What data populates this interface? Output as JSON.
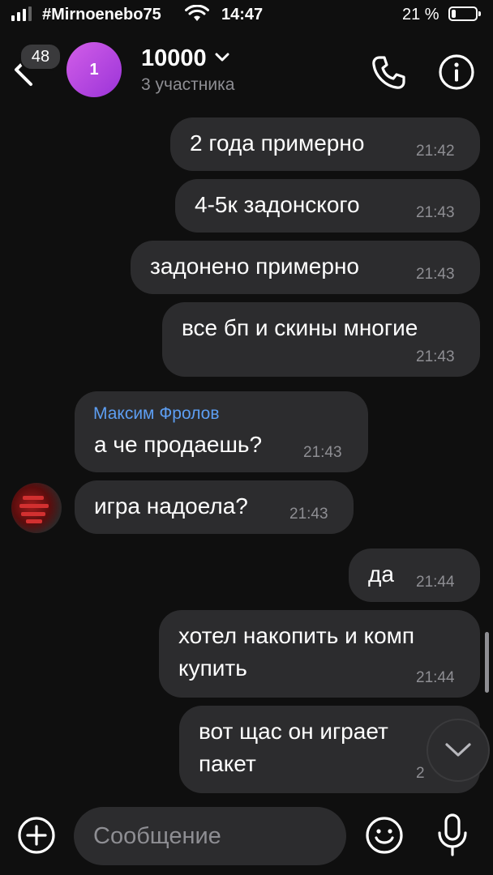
{
  "status_bar": {
    "carrier": "#Mirnoenebo75",
    "time": "14:47",
    "battery_percent": "21 %",
    "battery_level": 0.21,
    "signal_bars": 3
  },
  "header": {
    "unread_count": "48",
    "avatar_letter": "1",
    "title": "10000",
    "subtitle": "3 участника",
    "avatar_color": "#c34ee0"
  },
  "messages": [
    {
      "direction": "out",
      "text": "2 года примерно",
      "time": "21:42"
    },
    {
      "direction": "out",
      "text": "4-5к задонского",
      "time": "21:43"
    },
    {
      "direction": "out",
      "text": "задонено примерно",
      "time": "21:43"
    },
    {
      "direction": "out",
      "text": "все бп и скины многие",
      "time": "21:43"
    },
    {
      "direction": "in",
      "sender": "Максим Фролов",
      "text": "а че продаешь?",
      "time": "21:43"
    },
    {
      "direction": "in",
      "text": "игра надоела?",
      "time": "21:43"
    },
    {
      "direction": "out",
      "text": "да",
      "time": "21:44"
    },
    {
      "direction": "out",
      "text": "хотел накопить и комп\nкупить",
      "time": "21:44"
    },
    {
      "direction": "out",
      "text": "вот щас он играет\nпакет",
      "time": "2"
    }
  ],
  "input": {
    "placeholder": "Сообщение"
  },
  "icons": {
    "back": "chevron-left-icon",
    "call": "phone-icon",
    "info": "info-icon",
    "scroll_down": "chevron-down-icon",
    "add": "plus-circle-icon",
    "emoji": "smile-icon",
    "mic": "microphone-icon"
  },
  "colors": {
    "background": "#0f0f0f",
    "bubble": "#2c2c2e",
    "sender_name": "#5d9ef2",
    "secondary_text": "#8e8e93"
  }
}
